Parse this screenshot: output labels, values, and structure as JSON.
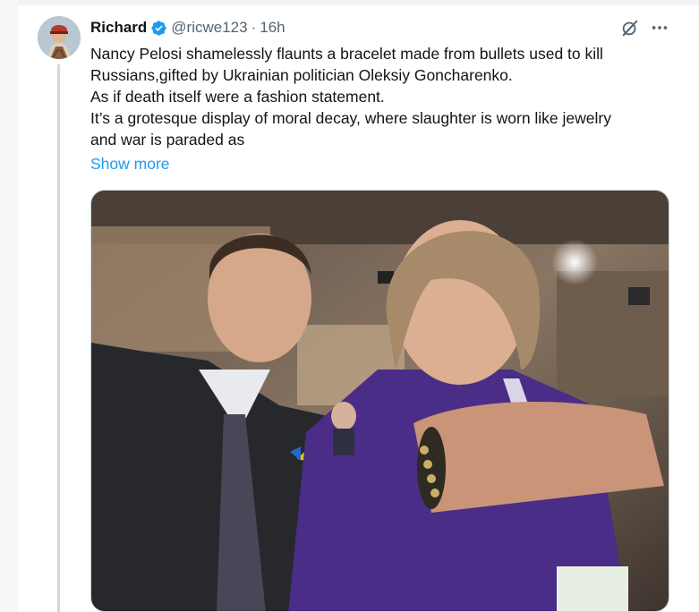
{
  "author": {
    "display_name": "Richard",
    "handle": "@ricwe123",
    "separator": "·",
    "time": "16h"
  },
  "tweet": {
    "lines": [
      "Nancy Pelosi shamelessly flaunts a bracelet made from bullets used to kill",
      "Russians,gifted by Ukrainian politician Oleksiy Goncharenko.",
      "As if death itself were a fashion statement.",
      "It’s a grotesque display of moral decay, where slaughter is worn like jewelry",
      "and war is paraded as"
    ],
    "show_more": "Show more"
  },
  "icons": {
    "verified": "verified-badge-icon",
    "grok": "grok-icon",
    "more": "more-options-icon"
  },
  "colors": {
    "link": "#1d9bf0",
    "verified": "#1d9bf0",
    "secondary_text": "#536471"
  }
}
